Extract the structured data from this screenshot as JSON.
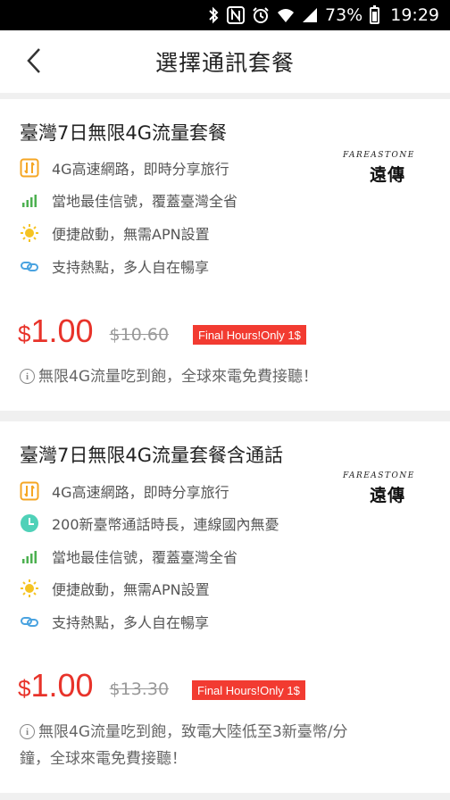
{
  "status": {
    "battery": "73%",
    "time": "19:29"
  },
  "header": {
    "title": "選擇通訊套餐"
  },
  "packages": [
    {
      "title": "臺灣7日無限4G流量套餐",
      "carrier": {
        "brand": "FAREASTONE",
        "chinese": "遠傳"
      },
      "features": [
        {
          "icon": "4g-data-icon",
          "text": "4G高速網路，即時分享旅行"
        },
        {
          "icon": "signal-bars-icon",
          "text": "當地最佳信號，覆蓋臺灣全省"
        },
        {
          "icon": "lightbulb-icon",
          "text": "便捷啟動，無需APN設置"
        },
        {
          "icon": "link-hotspot-icon",
          "text": "支持熱點，多人自在暢享"
        }
      ],
      "price": {
        "currency": "$",
        "amount": "1.00",
        "original": "$10.60",
        "badge": "Final Hours!Only 1$"
      },
      "note": "無限4G流量吃到飽，全球來電免費接聽！"
    },
    {
      "title": "臺灣7日無限4G流量套餐含通話",
      "carrier": {
        "brand": "FAREASTONE",
        "chinese": "遠傳"
      },
      "features": [
        {
          "icon": "4g-data-icon",
          "text": "4G高速網路，即時分享旅行"
        },
        {
          "icon": "clock-icon",
          "text": "200新臺幣通話時長，連線國內無憂"
        },
        {
          "icon": "signal-bars-icon",
          "text": "當地最佳信號，覆蓋臺灣全省"
        },
        {
          "icon": "lightbulb-icon",
          "text": "便捷啟動，無需APN設置"
        },
        {
          "icon": "link-hotspot-icon",
          "text": "支持熱點，多人自在暢享"
        }
      ],
      "price": {
        "currency": "$",
        "amount": "1.00",
        "original": "$13.30",
        "badge": "Final Hours!Only 1$"
      },
      "note_line1": "無限4G流量吃到飽，致電大陸低至3新臺幣/分",
      "note_line2": "鐘，全球來電免費接聽！"
    }
  ],
  "colors": {
    "price": "#e8332a",
    "badge": "#f23b31",
    "accent_orange": "#f5a623",
    "signal_green": "#4cb050",
    "clock_teal": "#4fd1b8",
    "link_blue": "#4aa3e0"
  }
}
